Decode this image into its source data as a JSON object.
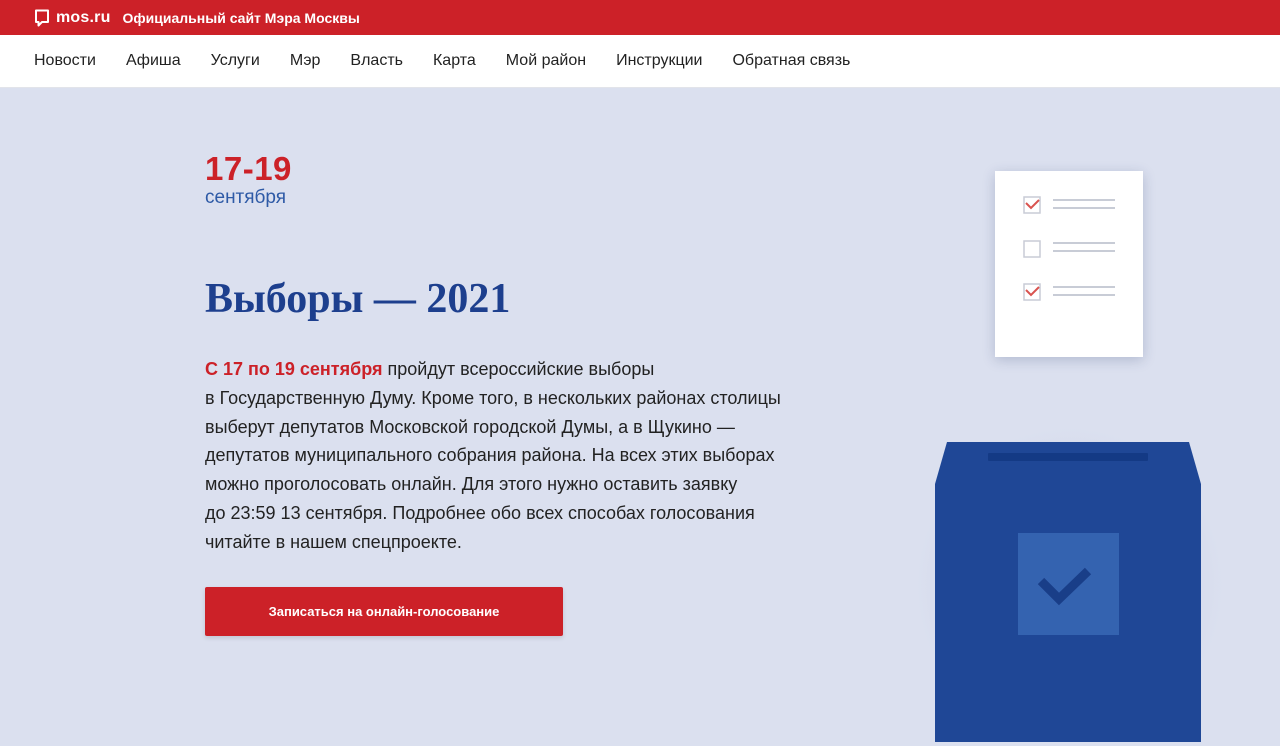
{
  "header": {
    "brand": "mos.ru",
    "tagline": "Официальный сайт Мэра Москвы"
  },
  "nav": {
    "items": [
      "Новости",
      "Афиша",
      "Услуги",
      "Мэр",
      "Власть",
      "Карта",
      "Мой район",
      "Инструкции",
      "Обратная связь"
    ]
  },
  "hero": {
    "dates": "17-19",
    "month": "сентября",
    "title": "Выборы — 2021",
    "intro_highlight": "С 17 по 19 сентября",
    "intro_lines": [
      " пройдут всероссийские выборы",
      "в Государственную Думу. Кроме того, в нескольких районах столицы",
      "выберут депутатов Московской городской Думы, а в Щукино —",
      "депутатов муниципального собрания района. На всех этих выборах",
      "можно проголосовать онлайн. Для этого нужно оставить заявку",
      "до 23:59 13 сентября. Подробнее обо всех способах голосования",
      "читайте в нашем спецпроекте."
    ],
    "cta_label": "Записаться на онлайн-голосование"
  },
  "colors": {
    "brand_red": "#cc2128",
    "navy": "#1d3f8e",
    "box_blue": "#1f4796",
    "page_bg": "#dbe0ef"
  },
  "icons": {
    "logo": "speech-bubble-icon",
    "ballot": "checklist-ballot-icon",
    "box": "ballot-box-checkmark-icon"
  }
}
